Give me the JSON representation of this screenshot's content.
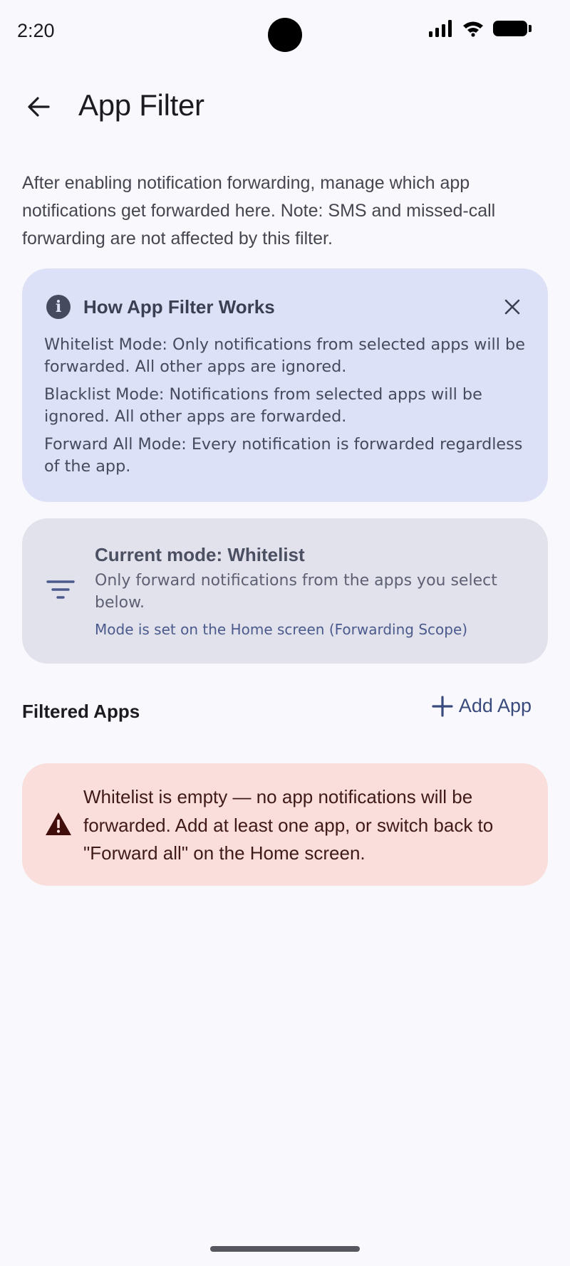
{
  "status_bar": {
    "time": "2:20",
    "icons": [
      "signal-icon",
      "wifi-icon",
      "battery-icon"
    ]
  },
  "header": {
    "back_icon": "arrow-left-icon",
    "title": "App Filter"
  },
  "intro": "After enabling notification forwarding, manage which app notifications get forwarded here. Note: SMS and missed-call forwarding are not affected by this filter.",
  "info_card": {
    "icon": "info-icon",
    "title": "How App Filter Works",
    "close_icon": "close-icon",
    "lines": [
      "Whitelist Mode: Only notifications from selected apps will be forwarded. All other apps are ignored.",
      "Blacklist Mode: Notifications from selected apps will be ignored. All other apps are forwarded.",
      "Forward All Mode: Every notification is forwarded regardless of the app."
    ]
  },
  "mode_card": {
    "icon": "filter-icon",
    "title": "Current mode: Whitelist",
    "description": "Only forward notifications from the apps you select below.",
    "note": "Mode is set on the Home screen (Forwarding Scope)"
  },
  "filtered_apps": {
    "header": "Filtered Apps",
    "add_icon": "plus-icon",
    "add_label": "Add App"
  },
  "warning": {
    "icon": "warning-icon",
    "text": "Whitelist is empty — no app notifications will be forwarded. Add at least one app, or switch back to \"Forward all\" on the Home screen."
  },
  "colors": {
    "background": "#f8f8fd",
    "info_card": "#dde1f8",
    "mode_card": "#e2e2ec",
    "warning_card": "#fadedc",
    "accent": "#3a4a7c"
  }
}
